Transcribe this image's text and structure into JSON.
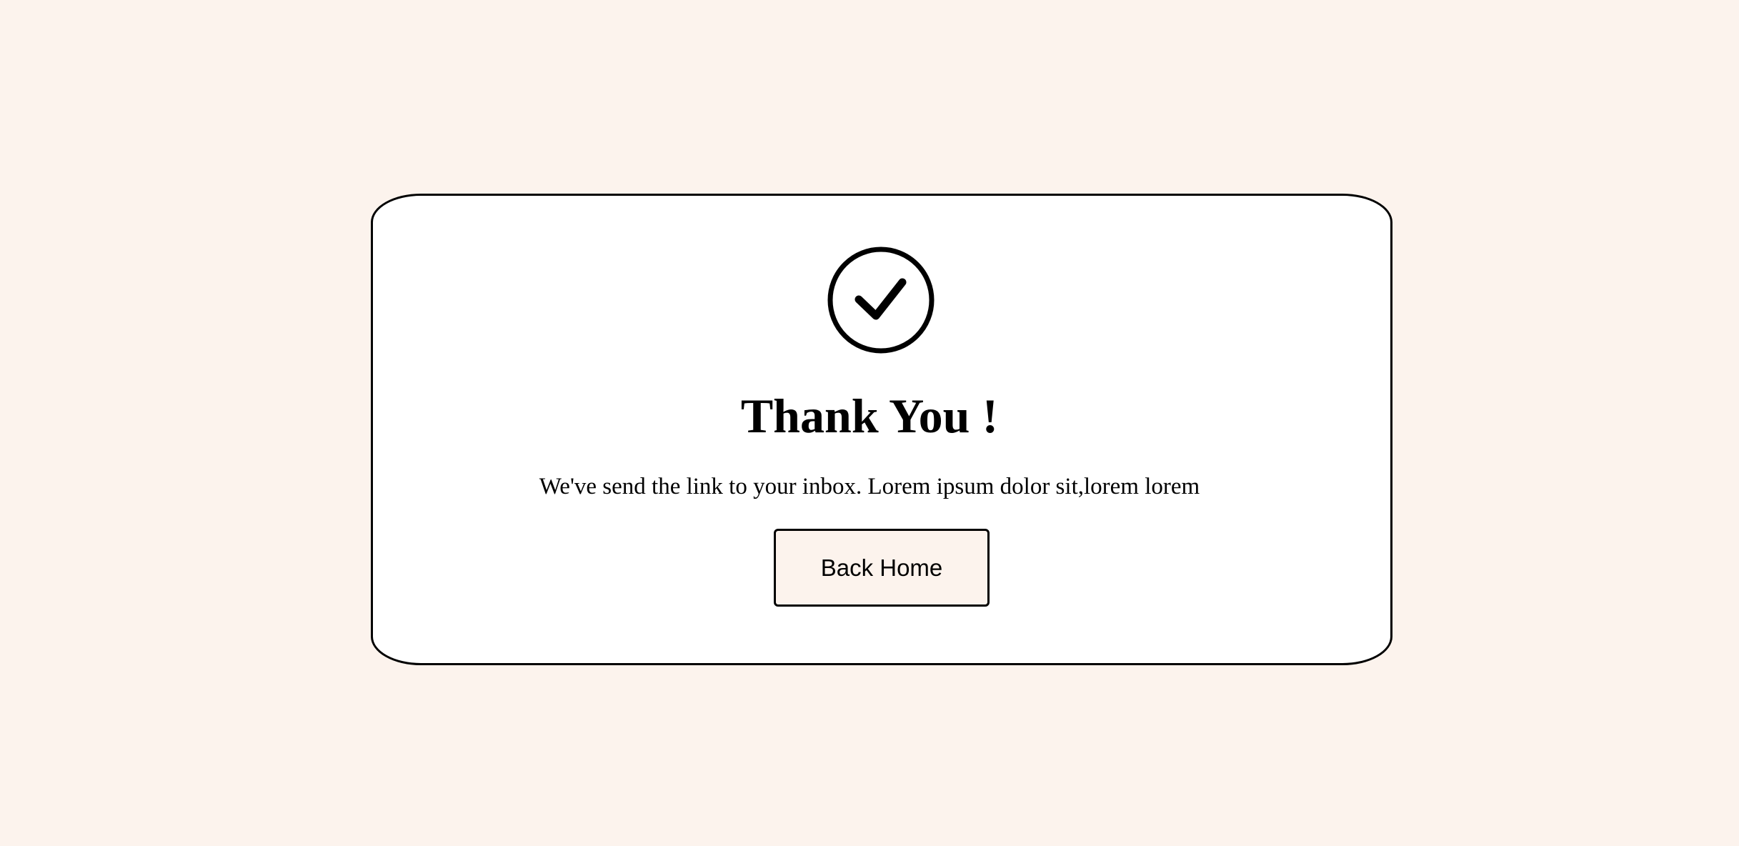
{
  "page": {
    "background_color": "#fcf3ed"
  },
  "card": {
    "background_color": "#ffffff",
    "border_color": "#000000",
    "icon": "check-circle-icon",
    "title": "Thank You !",
    "message": "We've send the link to your inbox. Lorem ipsum dolor sit,lorem lorem",
    "button_label": "Back Home",
    "button_color": "#fcf3ed"
  }
}
